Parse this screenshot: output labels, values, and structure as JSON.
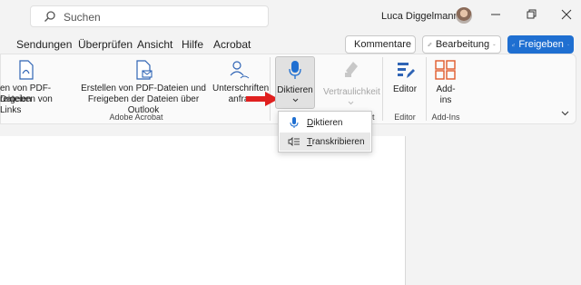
{
  "titlebar": {
    "search_placeholder": "Suchen",
    "user_name": "Luca Diggelmann"
  },
  "tabs": [
    "Sendungen",
    "Überprüfen",
    "Ansicht",
    "Hilfe",
    "Acrobat"
  ],
  "actions": {
    "comments": "Kommentare",
    "editing": "Bearbeitung",
    "share": "Freigeben"
  },
  "ribbon": {
    "btn1_line1": "en von PDF-Dateien",
    "btn1_line2": "reigeben von Links",
    "btn2_line1": "Erstellen von PDF-Dateien und",
    "btn2_line2": "Freigeben der Dateien über Outlook",
    "btn3_line1": "Unterschriften",
    "btn3_line2": "anfra",
    "group_acrobat": "Adobe Acrobat",
    "dictate": "Diktieren",
    "confidentiality": "Vertraulichkeit",
    "editor": "Editor",
    "addins_line1": "Add-",
    "addins_line2": "ins",
    "group_editor": "Editor",
    "group_addins": "Add-Ins",
    "group_partial": "t"
  },
  "dropdown": {
    "item1_u": "D",
    "item1_rest": "iktieren",
    "item2_u": "T",
    "item2_rest": "ranskribieren"
  },
  "colors": {
    "accent": "#1f6fd1",
    "arrow": "#e0201f",
    "addins": "#e05a2b"
  }
}
